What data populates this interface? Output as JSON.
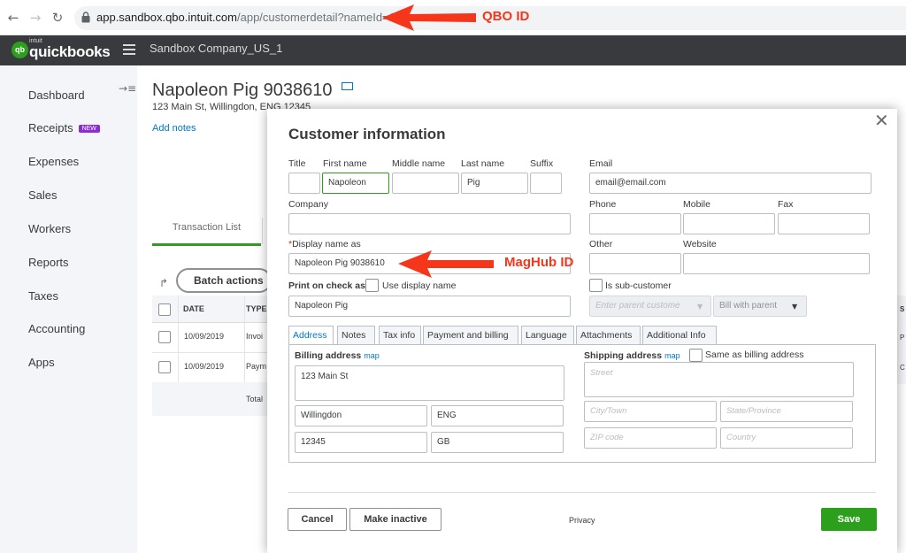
{
  "browser": {
    "url_main": "app.sandbox.qbo.intuit.com",
    "url_path": "/app/customerdetail?nameId=138"
  },
  "header": {
    "logo_small": "intuit",
    "logo": "quickbooks",
    "logo_badge": "qb",
    "company": "Sandbox Company_US_1"
  },
  "sidebar": {
    "items": [
      {
        "label": "Dashboard"
      },
      {
        "label": "Receipts",
        "badge": "NEW"
      },
      {
        "label": "Expenses"
      },
      {
        "label": "Sales"
      },
      {
        "label": "Workers"
      },
      {
        "label": "Reports"
      },
      {
        "label": "Taxes"
      },
      {
        "label": "Accounting"
      },
      {
        "label": "Apps"
      }
    ]
  },
  "customer_page": {
    "name": "Napoleon Pig 9038610",
    "address": "123 Main St, Willingdon, ENG 12345",
    "add_notes": "Add notes",
    "tab": "Transaction List",
    "batch_actions": "Batch actions",
    "table": {
      "headers": [
        "DATE",
        "TYPE"
      ],
      "rows": [
        {
          "date": "10/09/2019",
          "type": "Invoi"
        },
        {
          "date": "10/09/2019",
          "type": "Paym"
        }
      ],
      "total_label": "Total"
    },
    "right_edge": [
      "S",
      "P",
      "C"
    ]
  },
  "modal": {
    "title": "Customer information",
    "labels": {
      "title": "Title",
      "first_name": "First name",
      "middle_name": "Middle name",
      "last_name": "Last name",
      "suffix": "Suffix",
      "email": "Email",
      "company": "Company",
      "phone": "Phone",
      "mobile": "Mobile",
      "fax": "Fax",
      "display_name": "Display name as",
      "required_mark": "*",
      "other": "Other",
      "website": "Website",
      "print_on_check": "Print on check as",
      "use_display_name": "Use display name",
      "is_sub_customer": "Is sub-customer"
    },
    "values": {
      "title": "",
      "first_name": "Napoleon",
      "middle_name": "",
      "last_name": "Pig",
      "suffix": "",
      "email": "email@email.com",
      "company": "",
      "phone": "",
      "mobile": "",
      "fax": "",
      "display_name": "Napoleon Pig 9038610",
      "other": "",
      "website": "",
      "print_on_check": "Napoleon Pig",
      "parent_customer_placeholder": "Enter parent custome",
      "bill_with_parent": "Bill with parent"
    },
    "tabs": [
      "Address",
      "Notes",
      "Tax info",
      "Payment and billing",
      "Language",
      "Attachments",
      "Additional Info"
    ],
    "address": {
      "billing_label": "Billing address",
      "shipping_label": "Shipping address",
      "map_link": "map",
      "same_as_billing": "Same as billing address",
      "billing": {
        "street": "123 Main St",
        "city": "Willingdon",
        "state": "ENG",
        "zip": "12345",
        "country": "GB"
      },
      "shipping_placeholders": {
        "street": "Street",
        "city": "City/Town",
        "state": "State/Province",
        "zip": "ZIP code",
        "country": "Country"
      }
    },
    "footer": {
      "cancel": "Cancel",
      "make_inactive": "Make inactive",
      "privacy": "Privacy",
      "save": "Save"
    }
  },
  "annotations": {
    "qbo_id": "QBO ID",
    "maghub_id": "MagHub ID",
    "color": "#f5361a"
  },
  "colors": {
    "brand_green": "#2ca01c",
    "link_blue": "#0077c5",
    "header_dark": "#393a3d"
  }
}
